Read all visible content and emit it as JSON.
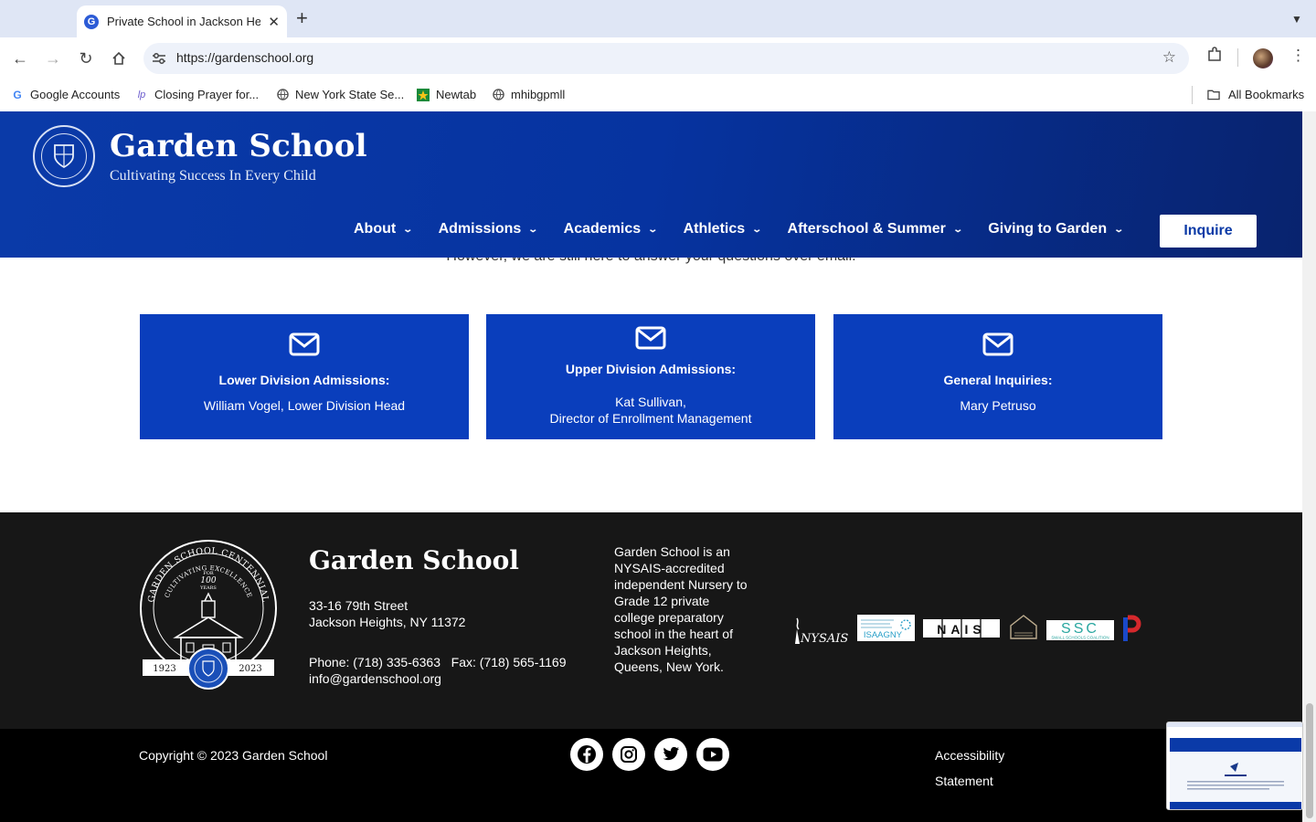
{
  "browser": {
    "tab_title": "Private School in Jackson Heights",
    "tab_favicon": "G",
    "url": "https://gardenschool.org",
    "bookmarks": [
      {
        "label": "Google Accounts",
        "icon": "google-icon"
      },
      {
        "label": "Closing Prayer for...",
        "icon": "lp-icon"
      },
      {
        "label": "New York State Se...",
        "icon": "globe-icon"
      },
      {
        "label": "Newtab",
        "icon": "newtab-icon"
      },
      {
        "label": "mhibgpmll",
        "icon": "globe-icon"
      }
    ],
    "all_bookmarks": "All Bookmarks"
  },
  "header": {
    "school_name": "Garden School",
    "tagline": "Cultivating Success In Every Child",
    "nav": [
      {
        "label": "About"
      },
      {
        "label": "Admissions"
      },
      {
        "label": "Academics"
      },
      {
        "label": "Athletics"
      },
      {
        "label": "Afterschool & Summer"
      },
      {
        "label": "Giving to Garden"
      }
    ],
    "inquire": "Inquire",
    "chevron": "▼"
  },
  "intro": "However, we are still here to answer your questions over email.",
  "contacts": [
    {
      "title": "Lower Division Admissions:",
      "name1": "William Vogel, Lower Division Head",
      "name2": ""
    },
    {
      "title": "Upper Division Admissions:",
      "name1": "Kat Sullivan,",
      "name2": "Director of Enrollment Management"
    },
    {
      "title": "General Inquiries:",
      "name1": "Mary Petruso",
      "name2": ""
    }
  ],
  "footer": {
    "school_name": "Garden School",
    "address_line1": "33-16 79th Street",
    "address_line2": "Jackson Heights, NY 11372",
    "phone_fax": "Phone: (718) 335-6363   Fax: (718) 565-1169",
    "email": "info@gardenschool.org",
    "about": "Garden School is an NYSAIS-accredited independent Nursery to Grade 12 private college preparatory school in the heart of Jackson Heights, Queens, New York.",
    "centennial": {
      "top_text": "GARDEN SCHOOL CENTENNIAL",
      "motto": "CULTIVATING EXCELLENCE",
      "for": "FOR",
      "years": "100",
      "years_label": "YEARS",
      "start": "1923",
      "end": "2023"
    },
    "logos": {
      "nysais": "NYSAIS",
      "isaagny": "ISAAGNY",
      "nais": "NAIS",
      "ssc": "SSC",
      "ssc_sub": "SMALL SCHOOLS COALITION",
      "p": "P"
    }
  },
  "bottom": {
    "copyright": "Copyright © 2023 Garden School",
    "social": [
      "facebook-icon",
      "instagram-icon",
      "twitter-icon",
      "youtube-icon"
    ],
    "accessibility": "Accessibility Statement"
  },
  "colors": {
    "header_blue": "#0a3aa8",
    "card_blue": "#0a3ebc",
    "footer": "#171717",
    "bottom": "#000000"
  }
}
